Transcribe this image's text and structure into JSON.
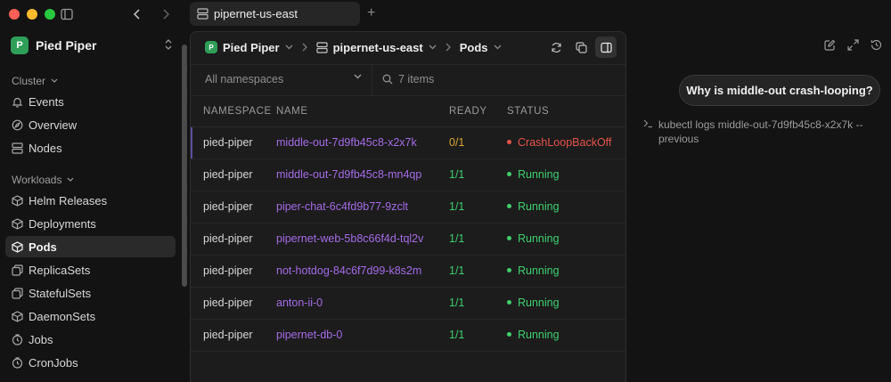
{
  "tab": {
    "title": "pipernet-us-east",
    "add_label": "+"
  },
  "workspace": {
    "name": "Pied Piper",
    "logo_text": "P"
  },
  "sidebar": {
    "sections": [
      {
        "label": "Cluster"
      },
      {
        "label": "Workloads"
      }
    ],
    "cluster_items": [
      {
        "label": "Events",
        "icon": "bell-icon"
      },
      {
        "label": "Overview",
        "icon": "compass-icon"
      },
      {
        "label": "Nodes",
        "icon": "server-icon"
      }
    ],
    "workload_items": [
      {
        "label": "Helm Releases",
        "icon": "box-icon"
      },
      {
        "label": "Deployments",
        "icon": "box-icon"
      },
      {
        "label": "Pods",
        "icon": "box-icon"
      },
      {
        "label": "ReplicaSets",
        "icon": "replica-icon"
      },
      {
        "label": "StatefulSets",
        "icon": "replica-icon"
      },
      {
        "label": "DaemonSets",
        "icon": "box-icon"
      },
      {
        "label": "Jobs",
        "icon": "clock-icon"
      },
      {
        "label": "CronJobs",
        "icon": "clock-icon"
      }
    ]
  },
  "breadcrumb": {
    "workspace": "Pied Piper",
    "cluster": "pipernet-us-east",
    "resource": "Pods"
  },
  "filter": {
    "namespace_placeholder": "All namespaces",
    "items_count": "7 items"
  },
  "table": {
    "headers": [
      "NAMESPACE",
      "NAME",
      "READY",
      "STATUS"
    ],
    "rows": [
      {
        "namespace": "pied-piper",
        "name": "middle-out-7d9fb45c8-x2x7k",
        "ready": "0/1",
        "status": "CrashLoopBackOff"
      },
      {
        "namespace": "pied-piper",
        "name": "middle-out-7d9fb45c8-mn4qp",
        "ready": "1/1",
        "status": "Running"
      },
      {
        "namespace": "pied-piper",
        "name": "piper-chat-6c4fd9b77-9zclt",
        "ready": "1/1",
        "status": "Running"
      },
      {
        "namespace": "pied-piper",
        "name": "pipernet-web-5b8c66f4d-tql2v",
        "ready": "1/1",
        "status": "Running"
      },
      {
        "namespace": "pied-piper",
        "name": "not-hotdog-84c6f7d99-k8s2m",
        "ready": "1/1",
        "status": "Running"
      },
      {
        "namespace": "pied-piper",
        "name": "anton-ii-0",
        "ready": "1/1",
        "status": "Running"
      },
      {
        "namespace": "pied-piper",
        "name": "pipernet-db-0",
        "ready": "1/1",
        "status": "Running"
      }
    ]
  },
  "chat": {
    "question": "Why is middle-out crash-looping?",
    "command": "kubectl logs middle-out-7d9fb45c8-x2x7k --previous"
  },
  "colors": {
    "status_error": "#e5534b",
    "status_ok": "#3fcf6d",
    "accent_purple": "#a56be6",
    "brand_green": "#2f9e58"
  }
}
